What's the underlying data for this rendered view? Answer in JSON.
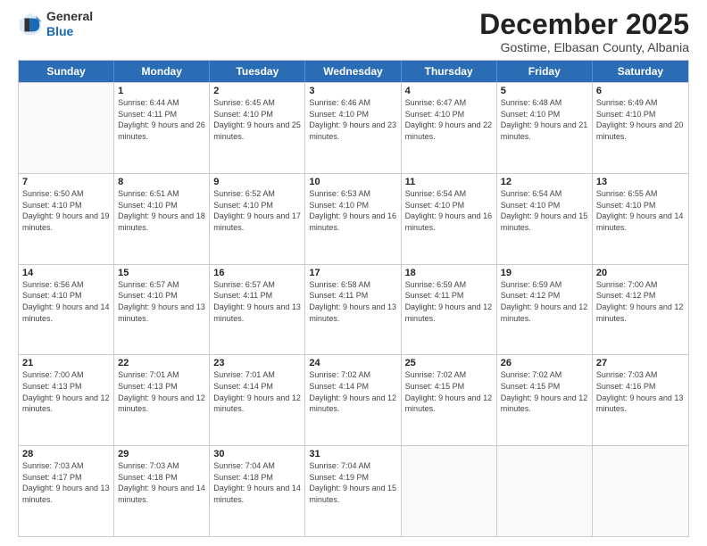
{
  "header": {
    "logo": {
      "text_general": "General",
      "text_blue": "Blue"
    },
    "title": "December 2025",
    "subtitle": "Gostime, Elbasan County, Albania"
  },
  "calendar": {
    "days_of_week": [
      "Sunday",
      "Monday",
      "Tuesday",
      "Wednesday",
      "Thursday",
      "Friday",
      "Saturday"
    ],
    "weeks": [
      [
        {
          "day": "",
          "empty": true
        },
        {
          "day": "1",
          "sunrise": "6:44 AM",
          "sunset": "4:11 PM",
          "daylight": "9 hours and 26 minutes."
        },
        {
          "day": "2",
          "sunrise": "6:45 AM",
          "sunset": "4:10 PM",
          "daylight": "9 hours and 25 minutes."
        },
        {
          "day": "3",
          "sunrise": "6:46 AM",
          "sunset": "4:10 PM",
          "daylight": "9 hours and 23 minutes."
        },
        {
          "day": "4",
          "sunrise": "6:47 AM",
          "sunset": "4:10 PM",
          "daylight": "9 hours and 22 minutes."
        },
        {
          "day": "5",
          "sunrise": "6:48 AM",
          "sunset": "4:10 PM",
          "daylight": "9 hours and 21 minutes."
        },
        {
          "day": "6",
          "sunrise": "6:49 AM",
          "sunset": "4:10 PM",
          "daylight": "9 hours and 20 minutes."
        }
      ],
      [
        {
          "day": "7",
          "sunrise": "6:50 AM",
          "sunset": "4:10 PM",
          "daylight": "9 hours and 19 minutes."
        },
        {
          "day": "8",
          "sunrise": "6:51 AM",
          "sunset": "4:10 PM",
          "daylight": "9 hours and 18 minutes."
        },
        {
          "day": "9",
          "sunrise": "6:52 AM",
          "sunset": "4:10 PM",
          "daylight": "9 hours and 17 minutes."
        },
        {
          "day": "10",
          "sunrise": "6:53 AM",
          "sunset": "4:10 PM",
          "daylight": "9 hours and 16 minutes."
        },
        {
          "day": "11",
          "sunrise": "6:54 AM",
          "sunset": "4:10 PM",
          "daylight": "9 hours and 16 minutes."
        },
        {
          "day": "12",
          "sunrise": "6:54 AM",
          "sunset": "4:10 PM",
          "daylight": "9 hours and 15 minutes."
        },
        {
          "day": "13",
          "sunrise": "6:55 AM",
          "sunset": "4:10 PM",
          "daylight": "9 hours and 14 minutes."
        }
      ],
      [
        {
          "day": "14",
          "sunrise": "6:56 AM",
          "sunset": "4:10 PM",
          "daylight": "9 hours and 14 minutes."
        },
        {
          "day": "15",
          "sunrise": "6:57 AM",
          "sunset": "4:10 PM",
          "daylight": "9 hours and 13 minutes."
        },
        {
          "day": "16",
          "sunrise": "6:57 AM",
          "sunset": "4:11 PM",
          "daylight": "9 hours and 13 minutes."
        },
        {
          "day": "17",
          "sunrise": "6:58 AM",
          "sunset": "4:11 PM",
          "daylight": "9 hours and 13 minutes."
        },
        {
          "day": "18",
          "sunrise": "6:59 AM",
          "sunset": "4:11 PM",
          "daylight": "9 hours and 12 minutes."
        },
        {
          "day": "19",
          "sunrise": "6:59 AM",
          "sunset": "4:12 PM",
          "daylight": "9 hours and 12 minutes."
        },
        {
          "day": "20",
          "sunrise": "7:00 AM",
          "sunset": "4:12 PM",
          "daylight": "9 hours and 12 minutes."
        }
      ],
      [
        {
          "day": "21",
          "sunrise": "7:00 AM",
          "sunset": "4:13 PM",
          "daylight": "9 hours and 12 minutes."
        },
        {
          "day": "22",
          "sunrise": "7:01 AM",
          "sunset": "4:13 PM",
          "daylight": "9 hours and 12 minutes."
        },
        {
          "day": "23",
          "sunrise": "7:01 AM",
          "sunset": "4:14 PM",
          "daylight": "9 hours and 12 minutes."
        },
        {
          "day": "24",
          "sunrise": "7:02 AM",
          "sunset": "4:14 PM",
          "daylight": "9 hours and 12 minutes."
        },
        {
          "day": "25",
          "sunrise": "7:02 AM",
          "sunset": "4:15 PM",
          "daylight": "9 hours and 12 minutes."
        },
        {
          "day": "26",
          "sunrise": "7:02 AM",
          "sunset": "4:15 PM",
          "daylight": "9 hours and 12 minutes."
        },
        {
          "day": "27",
          "sunrise": "7:03 AM",
          "sunset": "4:16 PM",
          "daylight": "9 hours and 13 minutes."
        }
      ],
      [
        {
          "day": "28",
          "sunrise": "7:03 AM",
          "sunset": "4:17 PM",
          "daylight": "9 hours and 13 minutes."
        },
        {
          "day": "29",
          "sunrise": "7:03 AM",
          "sunset": "4:18 PM",
          "daylight": "9 hours and 14 minutes."
        },
        {
          "day": "30",
          "sunrise": "7:04 AM",
          "sunset": "4:18 PM",
          "daylight": "9 hours and 14 minutes."
        },
        {
          "day": "31",
          "sunrise": "7:04 AM",
          "sunset": "4:19 PM",
          "daylight": "9 hours and 15 minutes."
        },
        {
          "day": "",
          "empty": true
        },
        {
          "day": "",
          "empty": true
        },
        {
          "day": "",
          "empty": true
        }
      ]
    ]
  }
}
